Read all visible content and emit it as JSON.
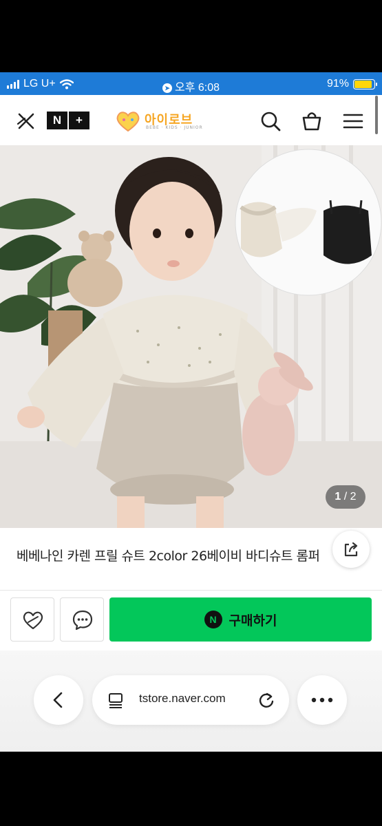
{
  "status_bar": {
    "carrier": "LG U+",
    "time": "오후 6:08",
    "battery": "91%",
    "battery_level": 0.91,
    "battery_color": "#ffd60a",
    "background_color": "#1e7bd7"
  },
  "header": {
    "close_icon": "close-icon",
    "nplus_badge": [
      "N",
      "+"
    ],
    "logo_text": "아이로브",
    "logo_sub": "BEBE · KIDS · JUNIOR",
    "icons": [
      "search-icon",
      "cart-icon",
      "menu-icon"
    ]
  },
  "product": {
    "image_alt": "product-photo",
    "page_current": "1",
    "page_total": "/ 2",
    "title": "베베나인 카렌 프릴 슈트 2color 26베이비 바디슈트 롬퍼"
  },
  "actions": {
    "wishlist_icon": "heart-icon",
    "talk_icon": "chat-icon",
    "buy_badge": "N",
    "buy_label": "구매하기",
    "buy_color": "#03c75a"
  },
  "browser": {
    "url": "tstore.naver.com",
    "back_icon": "back-arrow-icon",
    "reader_icon": "reader-icon",
    "reload_icon": "reload-icon",
    "more_icon": "more-icon"
  }
}
